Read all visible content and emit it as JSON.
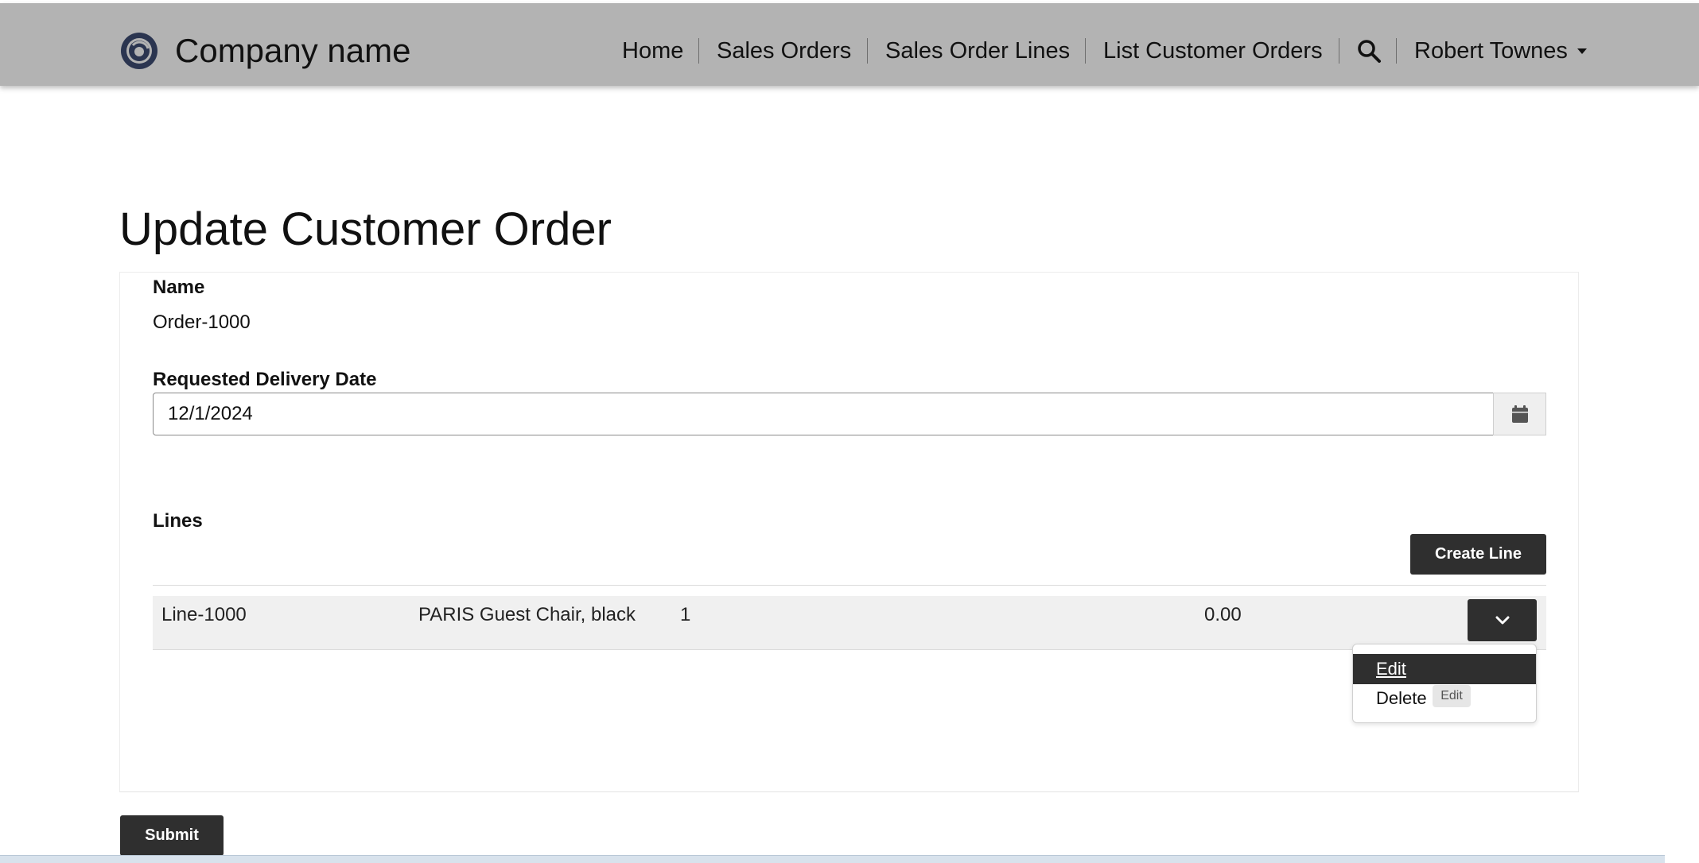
{
  "brand": {
    "name": "Company name",
    "logo_icon": "company-logo-icon"
  },
  "nav": {
    "items": [
      "Home",
      "Sales Orders",
      "Sales Order Lines",
      "List Customer Orders"
    ],
    "search_icon": "search-icon",
    "user_name": "Robert Townes"
  },
  "page": {
    "title": "Update Customer Order"
  },
  "form": {
    "name_label": "Name",
    "name_value": "Order-1000",
    "date_label": "Requested Delivery Date",
    "date_value": "12/1/2024",
    "calendar_icon": "calendar-icon",
    "lines_label": "Lines",
    "create_line_label": "Create Line",
    "submit_label": "Submit"
  },
  "lines": [
    {
      "line": "Line-1000",
      "product": "PARIS Guest Chair, black",
      "quantity": "1",
      "amount": "0.00"
    }
  ],
  "row_menu": {
    "toggle_icon": "chevron-down-icon",
    "items": [
      "Edit",
      "Delete"
    ],
    "tooltip": "Edit"
  },
  "colors": {
    "navbar": "#b3b3b3",
    "dark_button": "#2f2f2f",
    "row_background": "#f0f0f0"
  }
}
